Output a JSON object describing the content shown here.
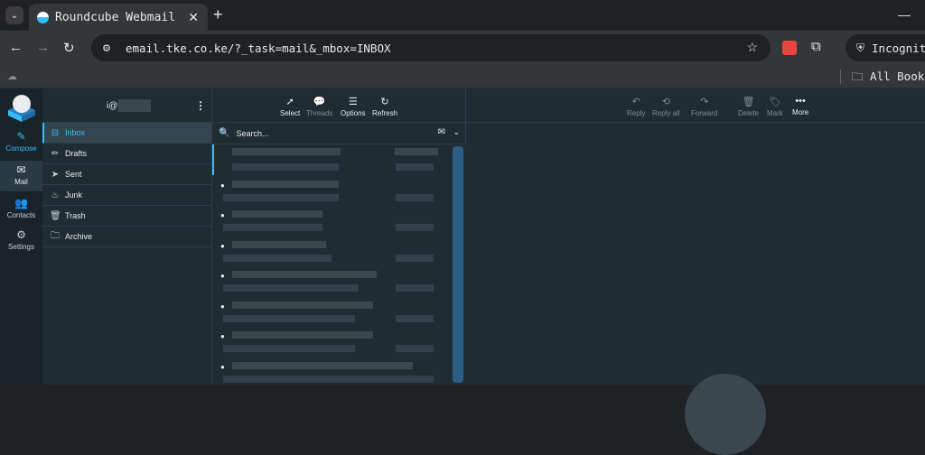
{
  "browser": {
    "tab_title": "Roundcube Webmail",
    "tab_close": "✕",
    "new_tab": "+",
    "minimize": "—",
    "url": "email.tke.co.ke/?_task=mail&_mbox=INBOX",
    "incognito_label": "Incognito",
    "bookmarks_all": "All Book"
  },
  "taskmenu": {
    "compose": "Compose",
    "mail": "Mail",
    "contacts": "Contacts",
    "settings": "Settings"
  },
  "account": {
    "username_visible": "i@t"
  },
  "folders": [
    {
      "label": "Inbox",
      "icon": "inbox-icon"
    },
    {
      "label": "Drafts",
      "icon": "pencil-icon"
    },
    {
      "label": "Sent",
      "icon": "send-icon"
    },
    {
      "label": "Junk",
      "icon": "fire-icon"
    },
    {
      "label": "Trash",
      "icon": "trash-icon"
    },
    {
      "label": "Archive",
      "icon": "folder-icon"
    }
  ],
  "list_toolbar": {
    "select": "Select",
    "threads": "Threads",
    "options": "Options",
    "refresh": "Refresh"
  },
  "search": {
    "placeholder": "Search..."
  },
  "message_toolbar": {
    "reply": "Reply",
    "reply_all": "Reply all",
    "forward": "Forward",
    "delete": "Delete",
    "mark": "Mark",
    "more": "More"
  },
  "colors": {
    "accent": "#37beff",
    "background": "#1f2c33",
    "taskmenu": "#19232a"
  }
}
